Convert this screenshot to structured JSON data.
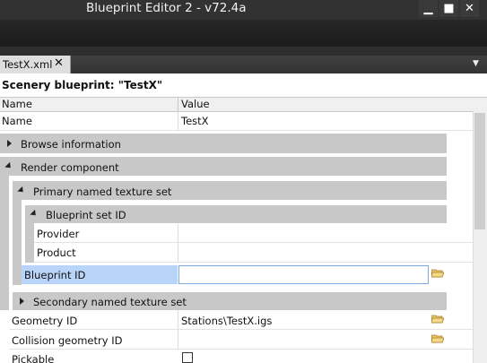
{
  "window": {
    "title": "Blueprint Editor 2 - v72.4a",
    "min": "▁",
    "max": "■",
    "close": "✕"
  },
  "tab": {
    "label": "TestX.xml",
    "close": "✕",
    "dropdown": "▼"
  },
  "heading": "Scenery blueprint: \"TestX\"",
  "columns": {
    "name": "Name",
    "value": "Value"
  },
  "rows": {
    "name": {
      "label": "Name",
      "value": "TestX"
    },
    "browse_information": "Browse information",
    "render_component": "Render component",
    "primary_texture_set": "Primary named texture set",
    "blueprint_set_id": "Blueprint set ID",
    "provider": "Provider",
    "product": "Product",
    "blueprint_id": {
      "label": "Blueprint ID",
      "value": ""
    },
    "secondary_texture_set": "Secondary named texture set",
    "geometry_id": {
      "label": "Geometry ID",
      "value": "Stations\\TestX.igs"
    },
    "collision_geometry_id": {
      "label": "Collision geometry ID",
      "value": ""
    },
    "partial_row": "Pickable"
  }
}
